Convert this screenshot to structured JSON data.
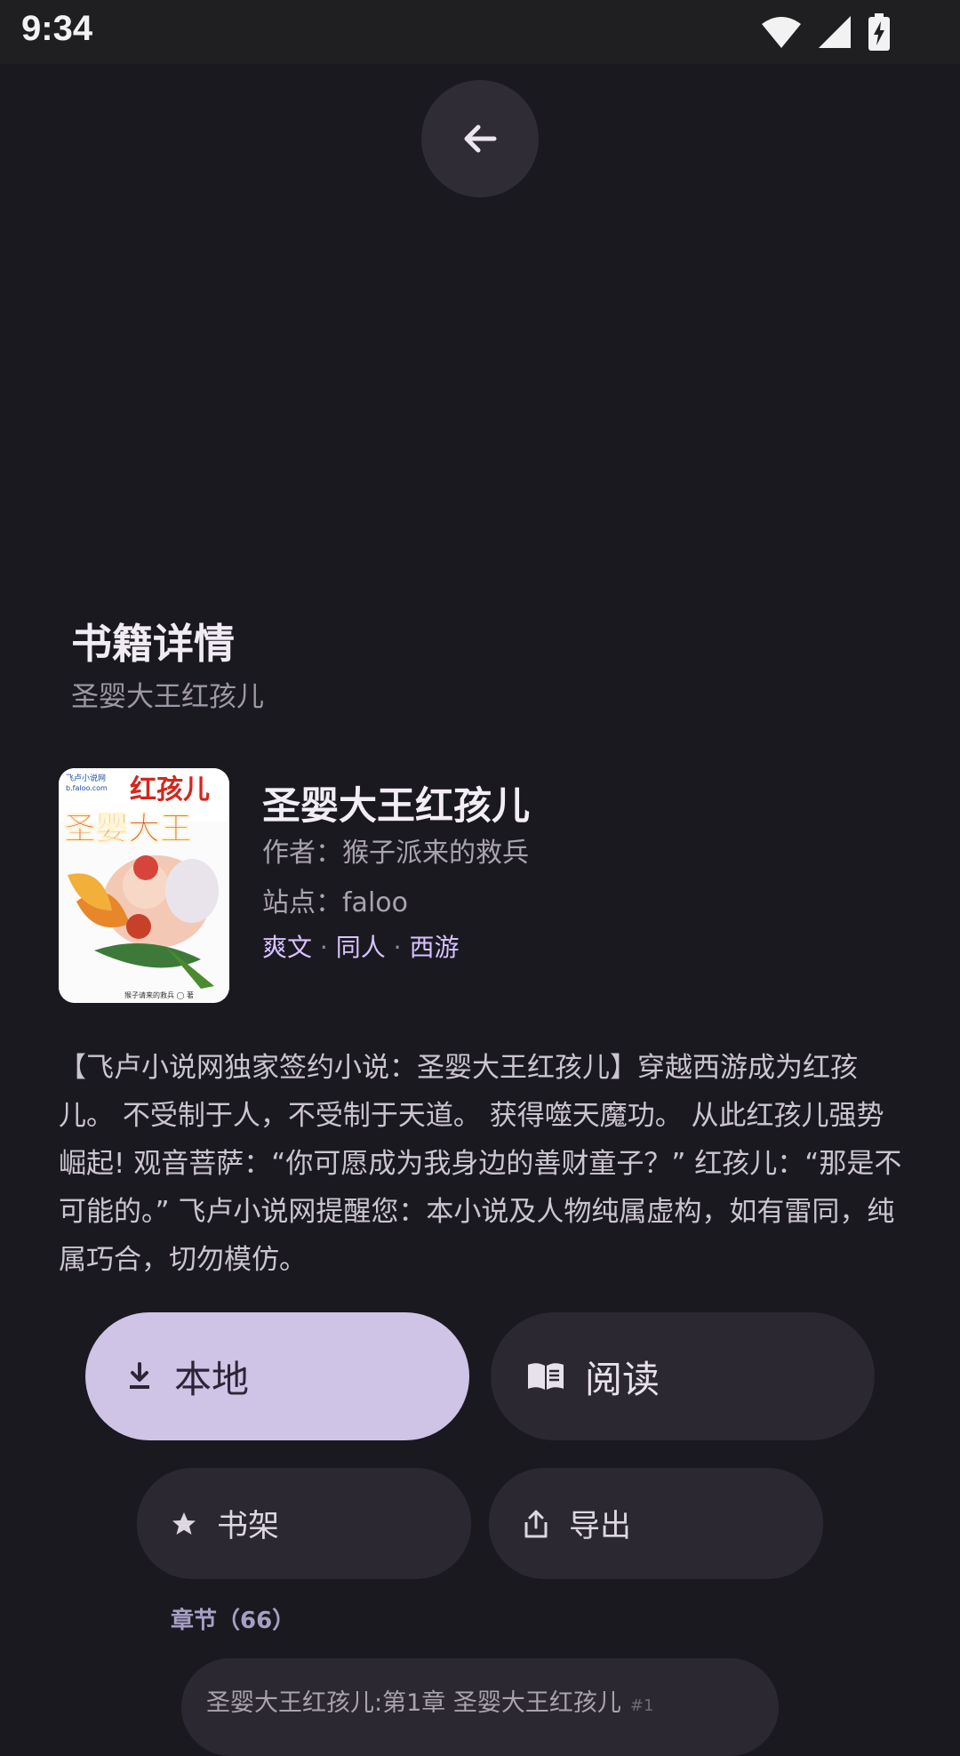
{
  "status_bar": {
    "time": "9:34"
  },
  "header": {
    "title": "书籍详情",
    "subtitle": "圣婴大王红孩儿"
  },
  "book": {
    "title": "圣婴大王红孩儿",
    "author": "作者：猴子派来的救兵",
    "site": "站点：faloo",
    "tags": [
      "爽文",
      "同人",
      "西游"
    ],
    "tag_separator": "·",
    "cover_texts": {
      "top_title": "红孩儿",
      "main_title": "圣婴大王",
      "site_mark": "b.faloo.com",
      "site_name": "飞卢小说网",
      "author_line": "猴子请来的救兵 ◯ 著"
    },
    "summary": "【飞卢小说网独家签约小说：圣婴大王红孩儿】穿越西游成为红孩儿。 不受制于人，不受制于天道。 获得噬天魔功。 从此红孩儿强势崛起! 观音菩萨：“你可愿成为我身边的善财童子？” 红孩儿：“那是不可能的。” 飞卢小说网提醒您：本小说及人物纯属虚构，如有雷同，纯属巧合，切勿模仿。"
  },
  "actions": {
    "local_label": "本地",
    "read_label": "阅读",
    "shelf_label": "书架",
    "export_label": "导出"
  },
  "chapters": {
    "header": "章节（66）",
    "items": [
      {
        "title": "圣婴大王红孩儿:第1章 圣婴大王红孩儿",
        "num": "#1"
      }
    ]
  },
  "colors": {
    "background": "#1b1920",
    "primary_button": "#cfc3e6",
    "tag_accent": "#d7c3ff",
    "surface": "#2b2832"
  }
}
